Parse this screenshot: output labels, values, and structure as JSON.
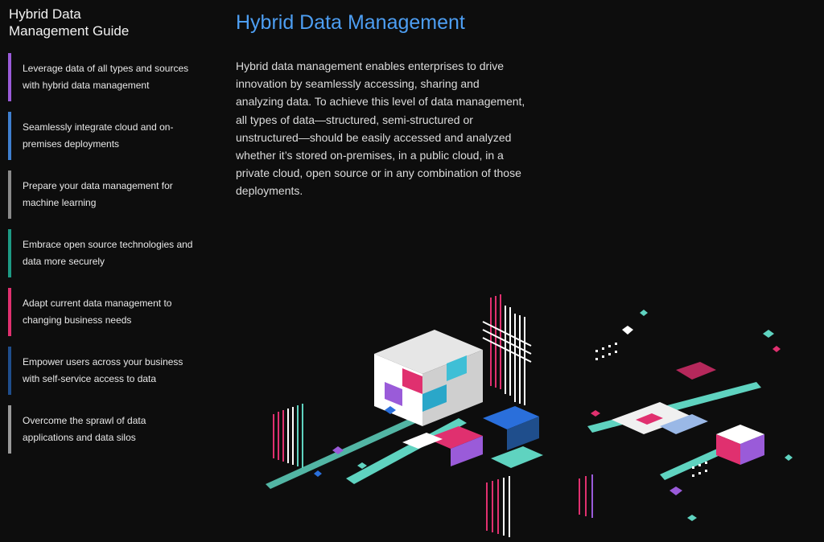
{
  "sidebar": {
    "guide_title": "Hybrid Data\nManagement Guide",
    "items": [
      {
        "label": "Leverage data of all types and sources with hybrid data management",
        "color": "#9a5bd9"
      },
      {
        "label": "Seamlessly integrate cloud and on-premises deployments",
        "color": "#3f7fcf"
      },
      {
        "label": "Prepare your data management for machine learning",
        "color": "#8a8a8a"
      },
      {
        "label": "Embrace open source technologies and data more securely",
        "color": "#1d9a84"
      },
      {
        "label": "Adapt current data management to changing business needs",
        "color": "#e0306f"
      },
      {
        "label": "Empower users across your business with self-service access to data",
        "color": "#1f4e8c"
      },
      {
        "label": "Overcome the sprawl of data applications and data silos",
        "color": "#9a9a9a"
      }
    ]
  },
  "main": {
    "title": "Hybrid Data Management",
    "intro": "Hybrid data management enables enterprises to drive innovation by seamlessly accessing, sharing and analyzing data. To achieve this level of data management, all types of data—structured, semi-structured or unstructured—should be easily accessed and analyzed whether it’s stored on-premises, in a public cloud, in a private cloud, open source or in any combination of those deployments."
  },
  "illustration": {
    "name": "isometric-data-cubes-illustration",
    "colors": {
      "teal": "#5fd3c0",
      "magenta": "#e0306f",
      "purple": "#9a5bd9",
      "blue": "#2a6fdb",
      "white": "#ffffff"
    }
  }
}
